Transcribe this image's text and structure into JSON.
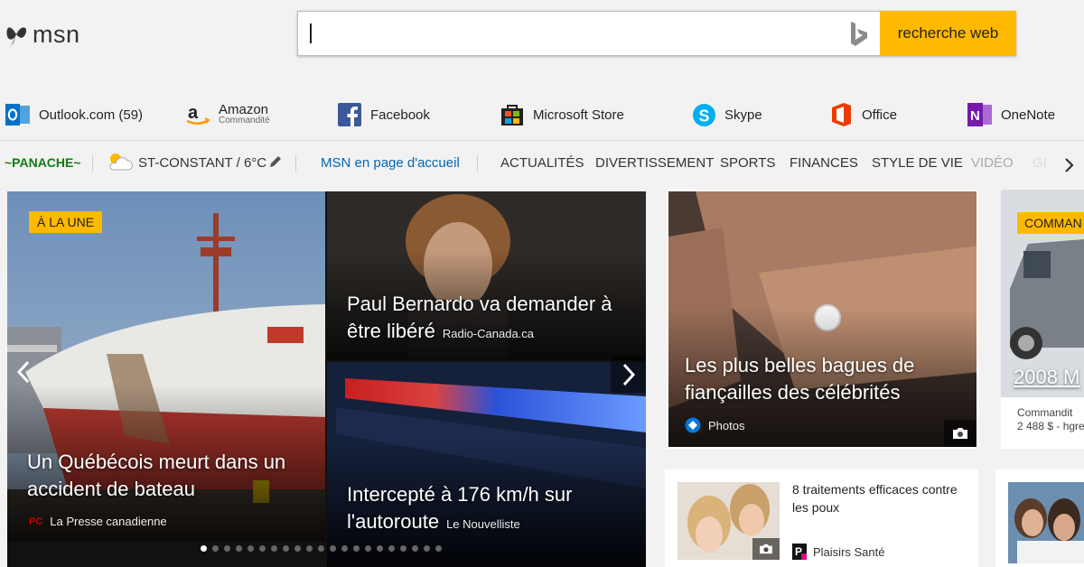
{
  "header": {
    "logo_text": "msn",
    "search": {
      "value": "",
      "button_label": "recherche web"
    }
  },
  "apps": [
    {
      "label": "Outlook.com",
      "count": "(59)",
      "icon": "outlook-icon",
      "color": "#0072c6"
    },
    {
      "label": "Amazon",
      "sublabel": "Commandité",
      "icon": "amazon-icon",
      "color": "#ff9900"
    },
    {
      "label": "Facebook",
      "icon": "facebook-icon",
      "color": "#3b5998"
    },
    {
      "label": "Microsoft Store",
      "icon": "store-icon",
      "color": "#222222"
    },
    {
      "label": "Skype",
      "icon": "skype-icon",
      "color": "#00aff0"
    },
    {
      "label": "Office",
      "icon": "office-icon",
      "color": "#eb3c00"
    },
    {
      "label": "OneNote",
      "icon": "onenote-icon",
      "color": "#7719aa"
    }
  ],
  "nav": {
    "panache": "~PANACHE~",
    "weather": "ST-CONSTANT / 6°C",
    "home_link": "MSN en page d'accueil",
    "sections": [
      "ACTUALITÉS",
      "DIVERTISSEMENT",
      "SPORTS",
      "FINANCES",
      "STYLE DE VIE",
      "VIDÉO",
      "GI"
    ]
  },
  "hero": {
    "badge": "À LA UNE",
    "main": {
      "title_line1": "Un Québécois meurt dans un",
      "title_line2": "accident de bateau",
      "source": "La Presse canadienne"
    },
    "top_right": {
      "title_line1": "Paul Bernardo va demander à",
      "title_line2": "être libéré",
      "source": "Radio-Canada.ca"
    },
    "bottom_right": {
      "title_line1": "Intercepté à 176 km/h sur",
      "title_line2": "l'autoroute",
      "source": "Le Nouvelliste"
    },
    "dots_total": 21,
    "dots_active": 0
  },
  "cards": {
    "rings": {
      "title_line1": "Les plus belles bagues de",
      "title_line2": "fiançailles des célébrités",
      "source": "Photos"
    },
    "commandite": {
      "badge": "COMMAN",
      "title": "2008 M",
      "sponsored": "Commandit",
      "price": "2 488 $ - hgre"
    },
    "lice": {
      "title_line1": "8 traitements efficaces contre",
      "title_line2": "les poux",
      "source": "Plaisirs Santé"
    }
  },
  "colors": {
    "accent": "#ffb900",
    "link": "#0067b8",
    "panache": "#107c10"
  }
}
